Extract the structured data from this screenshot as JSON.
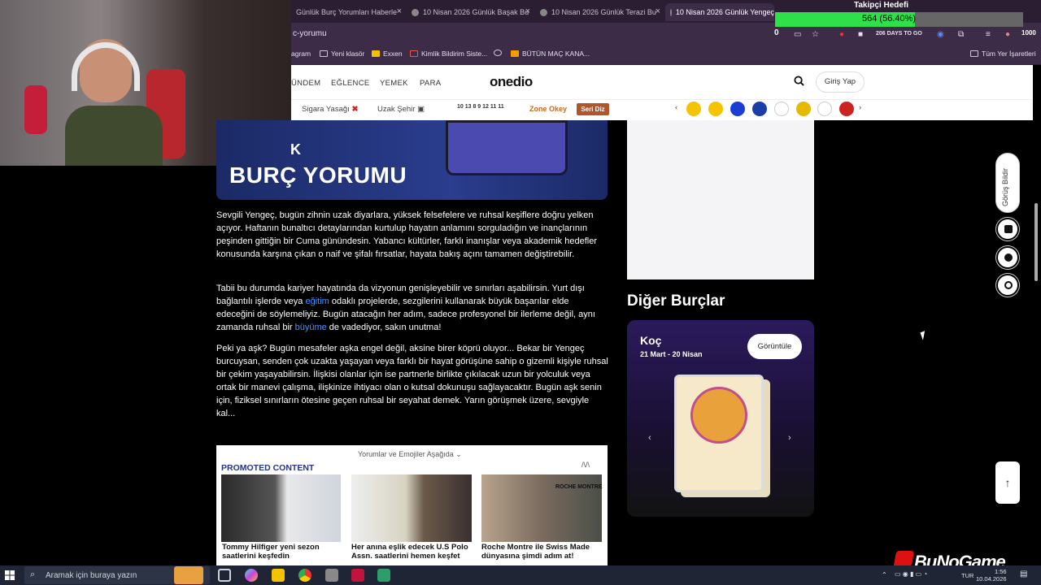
{
  "browser": {
    "tabs": [
      {
        "label": "Günlük Burç Yorumları Haberle"
      },
      {
        "label": "10 Nisan 2026 Günlük Başak Bu"
      },
      {
        "label": "10 Nisan 2026 Günlük Terazi Bu"
      },
      {
        "label": "10 Nisan 2026 Günlük Yengeç"
      }
    ],
    "address": "c-yorumu",
    "address_icons": {
      "counter": "0",
      "days": "206 DAYS TO GO"
    },
    "bookmarks": [
      "agram",
      "Yeni klasör",
      "Exxen",
      "Kimlik Bildirim Siste...",
      "BÜTÜN MAÇ KANA...",
      "Tüm Yer İşaretleri"
    ]
  },
  "follower_overlay": {
    "title": "Takipçi Hedefi",
    "count_text": "564 (56.40%)",
    "progress": 0.564,
    "goal": "1000"
  },
  "site": {
    "nav": [
      "ÜNDEM",
      "EĞLENCE",
      "YEMEK",
      "PARA"
    ],
    "logo": "onedio",
    "login": "Giriş Yap",
    "subnav": {
      "item1": "Sigara Yasağı",
      "item2": "Uzak Şehir",
      "lotto": "10 13 8 9 12 11 11",
      "zone": "Zone Okey",
      "seri": "Seri Diz"
    }
  },
  "article": {
    "hero_title": "BURÇ YORUMU",
    "hero_letter": "K",
    "paragraphs": {
      "p1": "Sevgili Yengeç, bugün zihnin uzak diyarlara, yüksek felsefelere ve ruhsal keşiflere doğru yelken açıyor. Haftanın bunaltıcı detaylarından kurtulup hayatın anlamını sorguladığın ve inançlarının peşinden gittiğin bir Cuma günündesin. Yabancı kültürler, farklı inanışlar veya akademik hedefler konusunda karşına çıkan o naif ve şifalı fırsatlar, hayata bakış açını tamamen değiştirebilir.",
      "p2a": "Tabii bu durumda kariyer hayatında da vizyonun genişleyebilir ve sınırları aşabilirsin. Yurt dışı bağlantılı işlerde veya ",
      "p2_link1": "eğitim",
      "p2b": " odaklı projelerde, sezgilerini kullanarak büyük başarılar elde edeceğini de söylemeliyiz. Bugün atacağın her adım, sadece profesyonel bir ilerleme değil, aynı zamanda ruhsal bir ",
      "p2_link2": "büyüme",
      "p2c": " de vadediyor, sakın unutma!",
      "p3": "Peki ya aşk? Bugün mesafeler aşka engel değil, aksine birer köprü oluyor... Bekar bir Yengeç burcuysan, senden çok uzakta yaşayan veya farklı bir hayat görüşüne sahip o gizemli kişiyle ruhsal bir çekim yaşayabilirsin. İlişkisi olanlar için ise partnerle birlikte çıkılacak uzun bir yolculuk veya ortak bir manevi çalışma, ilişkinize ihtiyacı olan o kutsal dokunuşu sağlayacaktır. Bugün aşk senin için, fiziksel sınırların ötesine geçen ruhsal bir seyahat demek. Yarın görüşmek üzere, sevgiyle kal..."
    }
  },
  "promoted": {
    "toggle": "Yorumlar ve Emojiler Aşağıda",
    "title": "PROMOTED CONTENT",
    "items": [
      {
        "caption": "Tommy Hilfiger yeni sezon saatlerini keşfedin"
      },
      {
        "caption": "Her anına eşlik edecek U.S Polo Assn. saatlerini hemen keşfet"
      },
      {
        "caption": "Roche Montre ile Swiss Made dünyasına şimdi adım at!"
      }
    ],
    "brand_label": "ROCHE MONTRE"
  },
  "sidebar": {
    "heading": "Diğer Burçlar",
    "card": {
      "name": "Koç",
      "dates": "21 Mart - 20 Nisan",
      "button": "Görüntüle"
    }
  },
  "floating": {
    "feedback": "Görüş Bildir"
  },
  "taskbar": {
    "search_placeholder": "Aramak için buraya yazın",
    "lang": "TUR",
    "time": "1:56",
    "date": "10.04.2026"
  },
  "watermark": "BuNoGame",
  "colors": {
    "accent": "#2ee04a",
    "link": "#4a90ff",
    "seri": "#b0562a"
  }
}
